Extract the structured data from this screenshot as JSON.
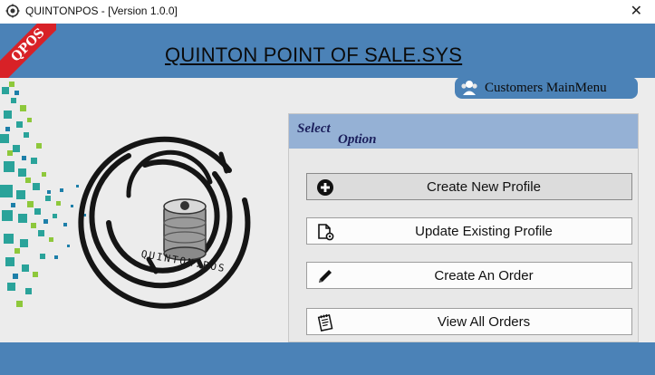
{
  "window": {
    "title": "QUINTONPOS - [Version 1.0.0]",
    "close_glyph": "✕",
    "app_icon": "gear-icon"
  },
  "header": {
    "app_name": "QUINTON POINT OF SALE.SYS",
    "ribbon_text": "QPOS",
    "background": "#4b82b7",
    "ribbon_color": "#d82127"
  },
  "customers_menu": {
    "label": "Customers MainMenu",
    "icon": "users-icon"
  },
  "panel": {
    "heading_word1": "Select",
    "heading_word2": "Option",
    "header_color": "#95b1d5",
    "options": [
      {
        "label": "Create New Profile",
        "icon": "plus-circle-icon",
        "active": true
      },
      {
        "label": "Update Existing Profile",
        "icon": "document-gear-icon",
        "active": false
      },
      {
        "label": "Create An Order",
        "icon": "pencil-icon",
        "active": false
      },
      {
        "label": "View All Orders",
        "icon": "notepad-icon",
        "active": false
      }
    ]
  },
  "logo": {
    "text": "QUINTON.POS"
  }
}
